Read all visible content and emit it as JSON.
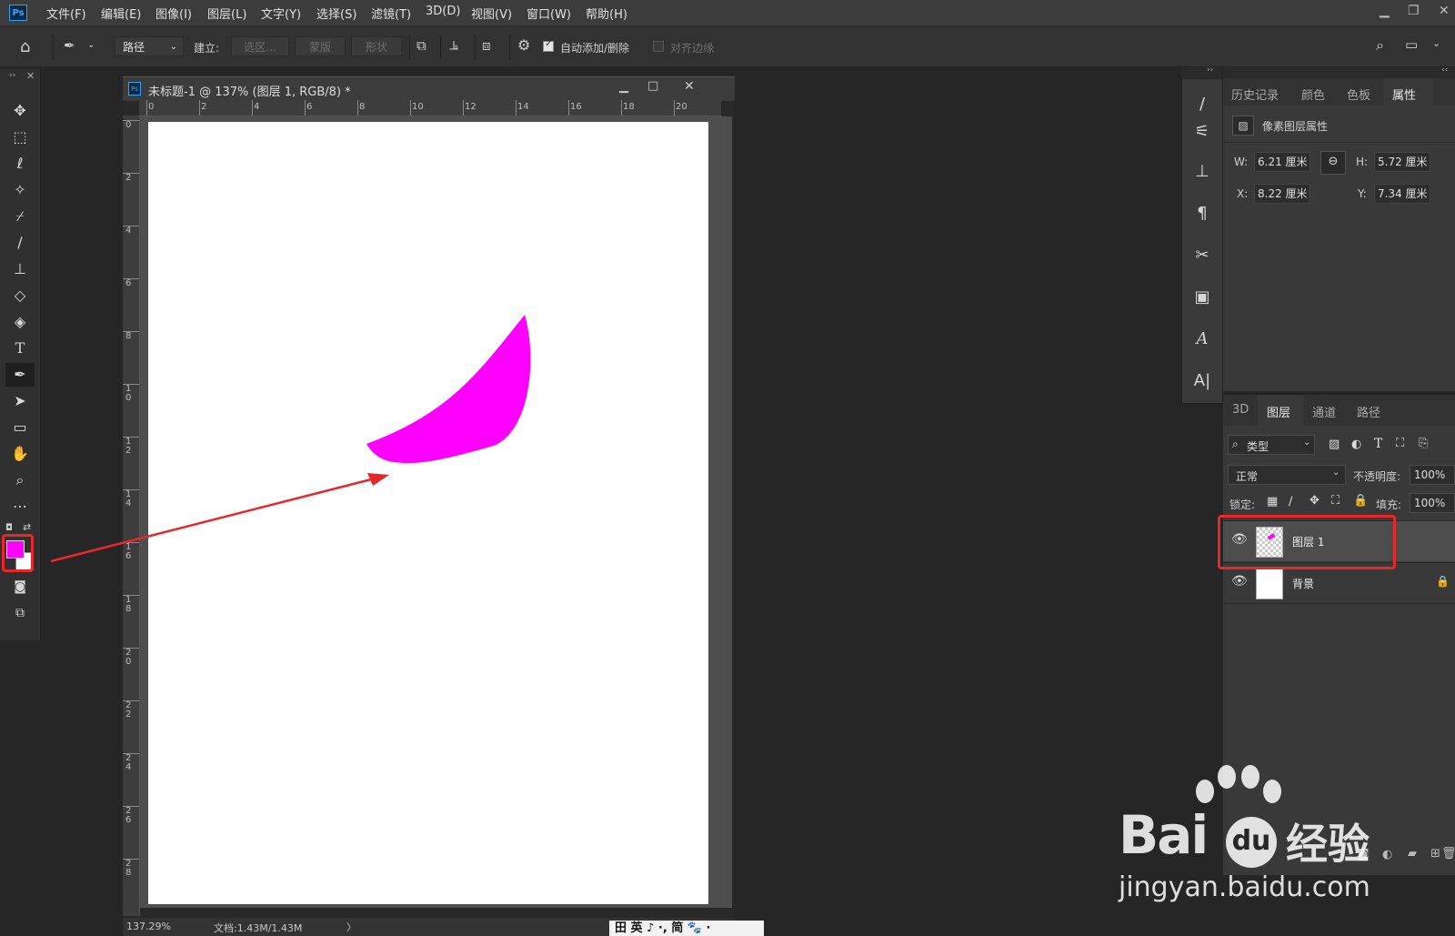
{
  "app": {
    "logo": "Ps",
    "menu": [
      "文件(F)",
      "编辑(E)",
      "图像(I)",
      "图层(L)",
      "文字(Y)",
      "选择(S)",
      "滤镜(T)",
      "3D(D)",
      "视图(V)",
      "窗口(W)",
      "帮助(H)"
    ]
  },
  "options": {
    "mode_select": "路径",
    "build_label": "建立:",
    "selection_btn": "选区...",
    "mask_btn": "蒙版",
    "shape_btn": "形状",
    "auto_add_label": "自动添加/删除",
    "align_edges_label": "对齐边缘"
  },
  "toolbar": {
    "tools": [
      "move-tool",
      "marquee-tool",
      "lasso-tool",
      "magic-wand-tool",
      "eyedropper-tool",
      "brush-tool",
      "stamp-tool",
      "eraser-tool",
      "paint-bucket-tool",
      "type-tool",
      "pen-tool",
      "path-select-tool",
      "rectangle-tool",
      "hand-tool",
      "zoom-tool",
      "more-tool"
    ],
    "foreground_color": "#ff00ff",
    "background_color": "#ffffff"
  },
  "document": {
    "title": "未标题-1 @ 137% (图层 1, RGB/8) *",
    "ruler_top": [
      "0",
      "2",
      "4",
      "6",
      "8",
      "10",
      "12",
      "14",
      "16",
      "18",
      "20"
    ],
    "ruler_left": [
      "0",
      "2",
      "4",
      "6",
      "8",
      "10",
      "12",
      "14",
      "16",
      "18",
      "20",
      "22",
      "24",
      "26",
      "28"
    ],
    "zoom": "137.29%",
    "doc_size": "文档:1.43M/1.43M",
    "shape_color": "#ff00ff"
  },
  "properties": {
    "tabs": [
      "历史记录",
      "颜色",
      "色板",
      "属性"
    ],
    "active_tab": "属性",
    "section_title": "像素图层属性",
    "w_label": "W:",
    "w_value": "6.21 厘米",
    "h_label": "H:",
    "h_value": "5.72 厘米",
    "x_label": "X:",
    "x_value": "8.22 厘米",
    "y_label": "Y:",
    "y_value": "7.34 厘米"
  },
  "layers": {
    "tabs": [
      "3D",
      "图层",
      "通道",
      "路径"
    ],
    "active_tab": "图层",
    "filter_kind": "类型",
    "blend_mode": "正常",
    "opacity_label": "不透明度:",
    "opacity_value": "100%",
    "lock_label": "锁定:",
    "fill_label": "填充:",
    "fill_value": "100%",
    "items": [
      {
        "name": "图层 1",
        "selected": true
      },
      {
        "name": "背景",
        "locked": true
      }
    ]
  },
  "watermark": {
    "brand_a": "Bai",
    "brand_b": "du",
    "brand_cn": "经验",
    "url": "jingyan.baidu.com"
  },
  "ime_bar": "田 英 ♪ ·, 简 🐾 ·"
}
